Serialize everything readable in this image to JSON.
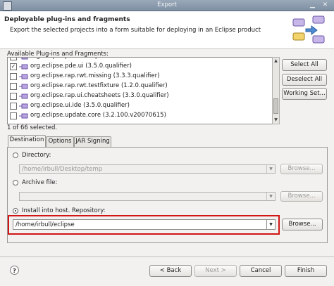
{
  "window": {
    "title": "Export"
  },
  "header": {
    "title": "Deployable plug-ins and fragments",
    "description": "Export the selected projects into a form suitable for deploying in an Eclipse product"
  },
  "plugins": {
    "label": "Available Plug-ins and Fragments:",
    "items": [
      {
        "label": "org.eclipse.pde.ui (3.5.0.qualifier)",
        "checked": true
      },
      {
        "label": "org.eclipse.rap.rwt.missing (3.3.3.qualifier)",
        "checked": false
      },
      {
        "label": "org.eclipse.rap.rwt.testfixture (1.2.0.qualifier)",
        "checked": false
      },
      {
        "label": "org.eclipse.rap.ui.cheatsheets (3.3.0.qualifier)",
        "checked": false
      },
      {
        "label": "org.eclipse.ui.ide (3.5.0.qualifier)",
        "checked": false
      },
      {
        "label": "org.eclipse.update.core (3.2.100.v20070615)",
        "checked": false
      }
    ],
    "status": "1 of 66 selected.",
    "buttons": {
      "select_all": "Select All",
      "deselect_all": "Deselect All",
      "working_set": "Working Set..."
    }
  },
  "tabs": [
    {
      "label": "Destination",
      "active": true
    },
    {
      "label": "Options",
      "active": false
    },
    {
      "label": "JAR Signing",
      "active": false
    }
  ],
  "destination": {
    "directory": {
      "label": "Directory:",
      "value": "/home/irbull/Desktop/temp",
      "browse": "Browse..."
    },
    "archive": {
      "label": "Archive file:",
      "value": "",
      "browse": "Browse..."
    },
    "repository": {
      "label": "Install into host. Repository:",
      "value": "/home/irbull/eclipse",
      "browse": "Browse..."
    }
  },
  "footer": {
    "help": "?",
    "back": "< Back",
    "next": "Next >",
    "cancel": "Cancel",
    "finish": "Finish"
  },
  "colors": {
    "highlight": "#d11616",
    "header_bg": "#ffffff",
    "dialog_bg": "#f2f1f0"
  }
}
